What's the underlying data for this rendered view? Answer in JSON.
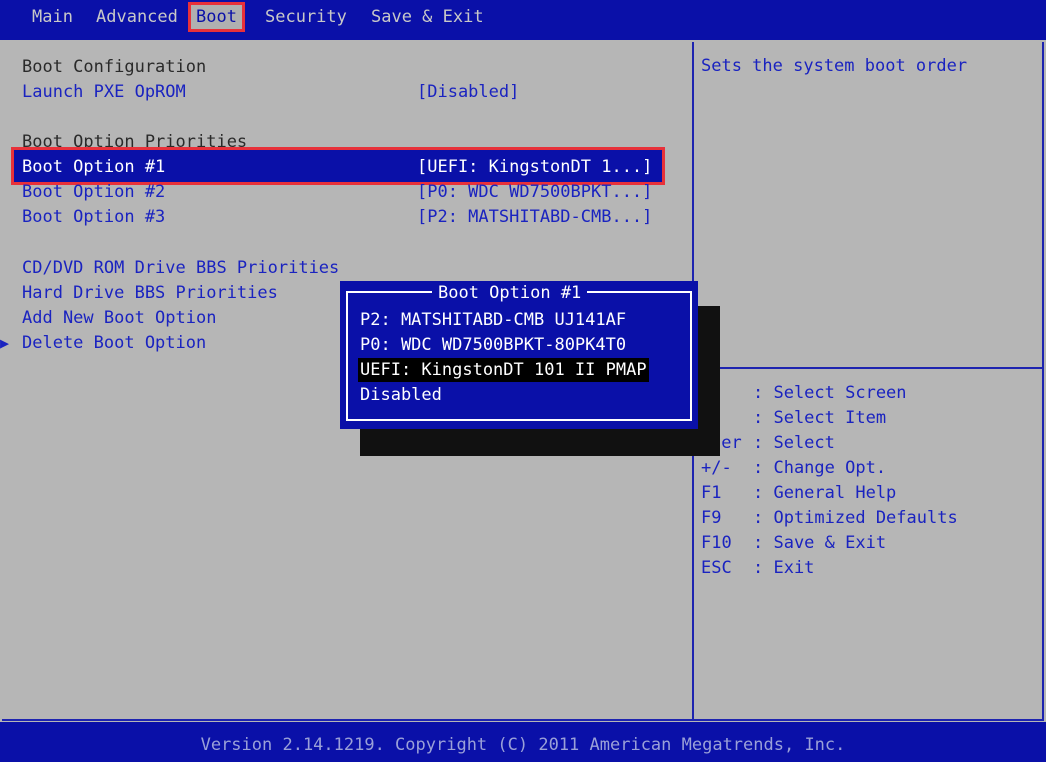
{
  "menu": {
    "tabs": [
      "Main",
      "Advanced",
      "Boot",
      "Security",
      "Save & Exit"
    ],
    "active": "Boot"
  },
  "left": {
    "boot_config_heading": "Boot Configuration",
    "pxe_label": "Launch PXE OpROM",
    "pxe_value": "[Disabled]",
    "priorities_heading": "Boot Option Priorities",
    "boot_options": [
      {
        "label": "Boot Option #1",
        "value": "[UEFI: KingstonDT 1...]"
      },
      {
        "label": "Boot Option #2",
        "value": "[P0: WDC WD7500BPKT...]"
      },
      {
        "label": "Boot Option #3",
        "value": "[P2: MATSHITABD-CMB...]"
      }
    ],
    "links": [
      "CD/DVD ROM Drive BBS Priorities",
      "Hard Drive BBS Priorities",
      "Add New Boot Option",
      "Delete Boot Option"
    ],
    "arrow": "▶"
  },
  "popup": {
    "title": "Boot Option #1",
    "items": [
      "P2: MATSHITABD-CMB UJ141AF",
      "P0: WDC WD7500BPKT-80PK4T0",
      "UEFI: KingstonDT 101 II PMAP",
      "Disabled"
    ],
    "selected_index": 2
  },
  "help": {
    "description": "Sets the system boot order",
    "keys": [
      {
        "key": "",
        "desc": ": Select Screen"
      },
      {
        "key": "",
        "desc": ": Select Item"
      },
      {
        "key": "ter",
        "desc": ": Select"
      },
      {
        "key": "+/-",
        "desc": ": Change Opt."
      },
      {
        "key": "F1",
        "desc": ": General Help"
      },
      {
        "key": "F9",
        "desc": ": Optimized Defaults"
      },
      {
        "key": "F10",
        "desc": ": Save & Exit"
      },
      {
        "key": "ESC",
        "desc": ": Exit"
      }
    ]
  },
  "footer": "Version 2.14.1219. Copyright (C) 2011 American Megatrends, Inc.",
  "colors": {
    "bios_blue": "#0a10a8",
    "panel_grey": "#b6b6b6",
    "highlight_red": "#e8313a"
  }
}
